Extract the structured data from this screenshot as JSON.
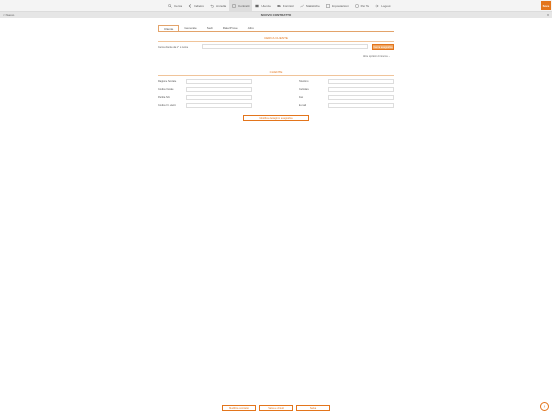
{
  "nav": {
    "items": [
      {
        "label": "Cerca",
        "icon": "search-icon"
      },
      {
        "label": "Indietro",
        "icon": "chevron-left-icon"
      },
      {
        "label": "Annulla",
        "icon": "undo-icon"
      },
      {
        "label": "Contratti",
        "icon": "document-icon"
      },
      {
        "label": "Utenze",
        "icon": "list-icon"
      },
      {
        "label": "Fornitori",
        "icon": "truck-icon"
      },
      {
        "label": "Statistiche",
        "icon": "chart-icon"
      },
      {
        "label": "Impostazioni",
        "icon": "gear-icon"
      },
      {
        "label": "Per Te",
        "icon": "star-icon"
      },
      {
        "label": "Logout",
        "icon": "logout-icon"
      }
    ],
    "active_index": 3,
    "logo_text": "Sore"
  },
  "titlebar": {
    "back_label": "< Nuovo",
    "title": "NUOVO CONTRATTO",
    "close_label": "X"
  },
  "tabs": [
    "Cliente",
    "Generale",
    "Sedi",
    "Rate/Prove",
    "Altro"
  ],
  "search": {
    "title": "CERCA CLIENTE",
    "label": "Cerca cliente da n° o nome",
    "value": "",
    "button": "Cerca anagrafica",
    "more_link": "Altre opzioni di ricerca ⌄"
  },
  "client": {
    "title": "CLIENTE",
    "left_fields": [
      "Ragione Sociale",
      "Codice fiscale",
      "Partita IVA",
      "Codice Ft. elettr."
    ],
    "right_fields": [
      "Telefono",
      "Cellulare",
      "Fax",
      "E-mail"
    ],
    "modify_button": "Modifica dettagli in anagrafica"
  },
  "footer": {
    "btn_left": "Modifica contratto",
    "btn_mid": "Salva e chiudi",
    "btn_right": "Salva"
  }
}
